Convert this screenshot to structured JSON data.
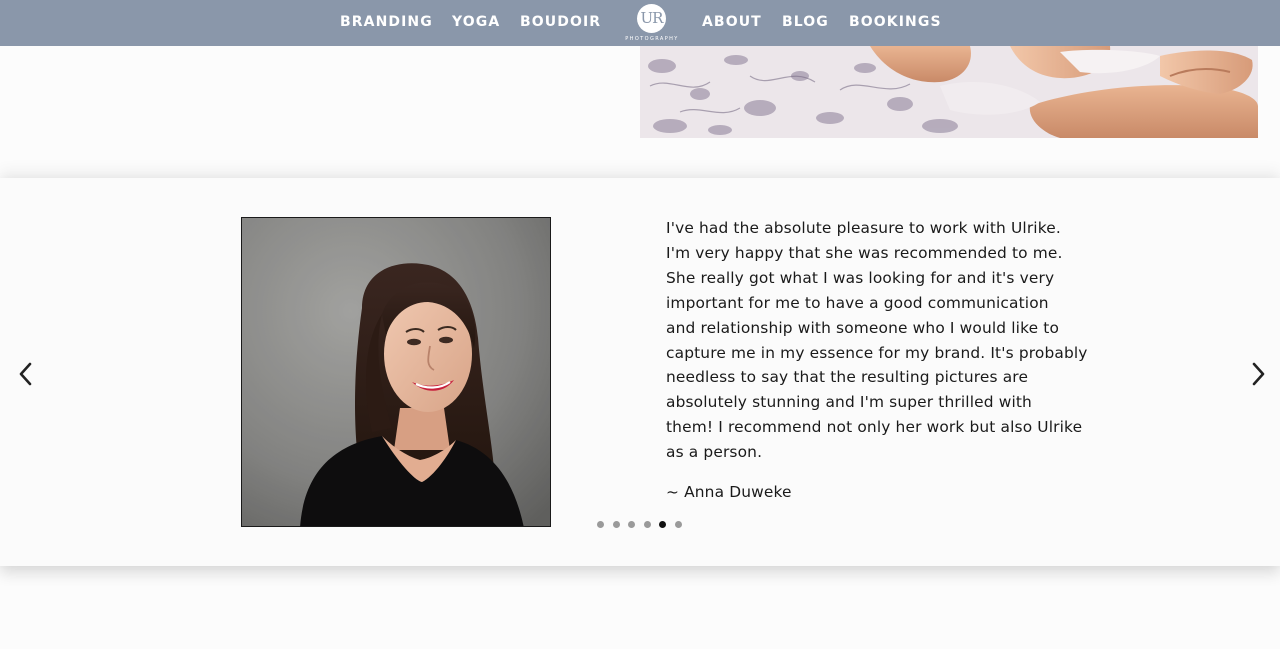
{
  "nav": {
    "left_items": [
      {
        "label": "BRANDING"
      },
      {
        "label": "YOGA"
      },
      {
        "label": "BOUDOIR"
      }
    ],
    "right_items": [
      {
        "label": "ABOUT"
      },
      {
        "label": "BLOG"
      },
      {
        "label": "BOOKINGS"
      }
    ],
    "logo": {
      "letters": "UR",
      "subtitle": "PHOTOGRAPHY"
    }
  },
  "colors": {
    "nav_background": "#8a97aa",
    "page_background": "#fcfcfc",
    "text": "#1a1a1a",
    "dot_inactive": "#9a9a9a",
    "dot_active": "#111111"
  },
  "testimonial": {
    "quote_lines": [
      "I've had the absolute pleasure to work with Ulrike.",
      "I'm very happy that she was recommended to me.",
      "She really got what I was looking for and it's very",
      "important for me to have a good communication",
      "and relationship with someone who I would like to",
      "capture me in my essence for my brand. It's probably",
      "needless to say that the resulting pictures are",
      "absolutely stunning and I'm super thrilled with",
      "them! I recommend not only her work but also Ulrike",
      "as a person."
    ],
    "author": "~ Anna Duweke"
  },
  "carousel": {
    "prev_icon": "chevron-left-icon",
    "next_icon": "chevron-right-icon",
    "slide_count": 6,
    "active_index": 4
  }
}
